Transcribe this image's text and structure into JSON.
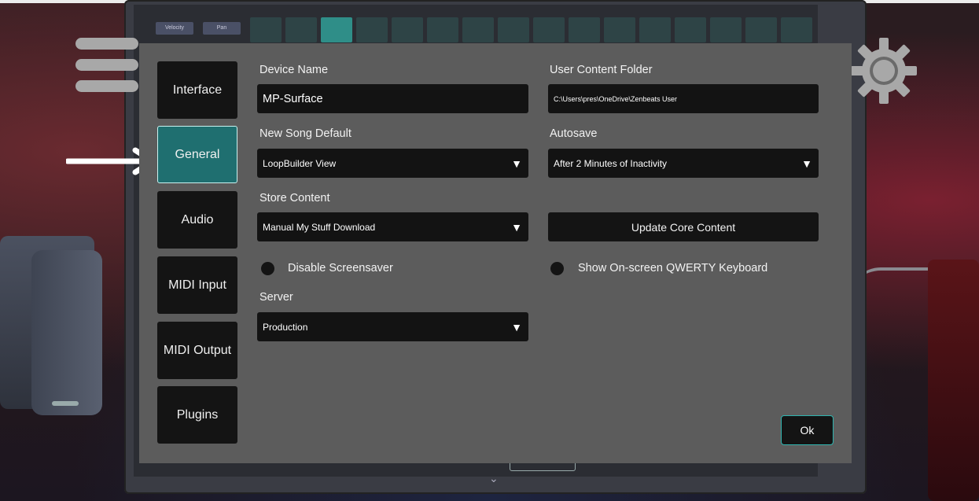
{
  "sidebar": {
    "items": [
      {
        "label": "Interface"
      },
      {
        "label": "General"
      },
      {
        "label": "Audio"
      },
      {
        "label": "MIDI Input"
      },
      {
        "label": "MIDI Output"
      },
      {
        "label": "Plugins"
      }
    ],
    "active": "General"
  },
  "general": {
    "device_name": {
      "label": "Device Name",
      "value": "MP-Surface"
    },
    "user_content_folder": {
      "label": "User Content Folder",
      "value": "C:\\Users\\pres\\OneDrive\\Zenbeats User"
    },
    "new_song_default": {
      "label": "New Song Default",
      "value": "LoopBuilder View"
    },
    "autosave": {
      "label": "Autosave",
      "value": "After 2 Minutes of Inactivity"
    },
    "store_content": {
      "label": "Store Content",
      "value": "Manual My Stuff Download"
    },
    "update_core_content": {
      "label": "Update Core Content"
    },
    "disable_screensaver": {
      "label": "Disable Screensaver",
      "checked": false
    },
    "show_qwerty": {
      "label": "Show On-screen QWERTY Keyboard",
      "checked": false
    },
    "server": {
      "label": "Server",
      "value": "Production"
    }
  },
  "footer": {
    "ok_label": "Ok"
  },
  "background": {
    "velocity_label": "Velocity",
    "pan_label": "Pan"
  },
  "colors": {
    "dialog_bg": "#5c5c5c",
    "active_tab": "#1f6f70",
    "active_tab_border": "#c9f2f0",
    "ok_border": "#2fb5b0",
    "field_bg": "#131313"
  },
  "icons": {
    "menu": "hamburger-icon",
    "pointer": "arrow-right-icon",
    "settings": "gear-icon",
    "dropdown": "triangle-down-icon"
  }
}
